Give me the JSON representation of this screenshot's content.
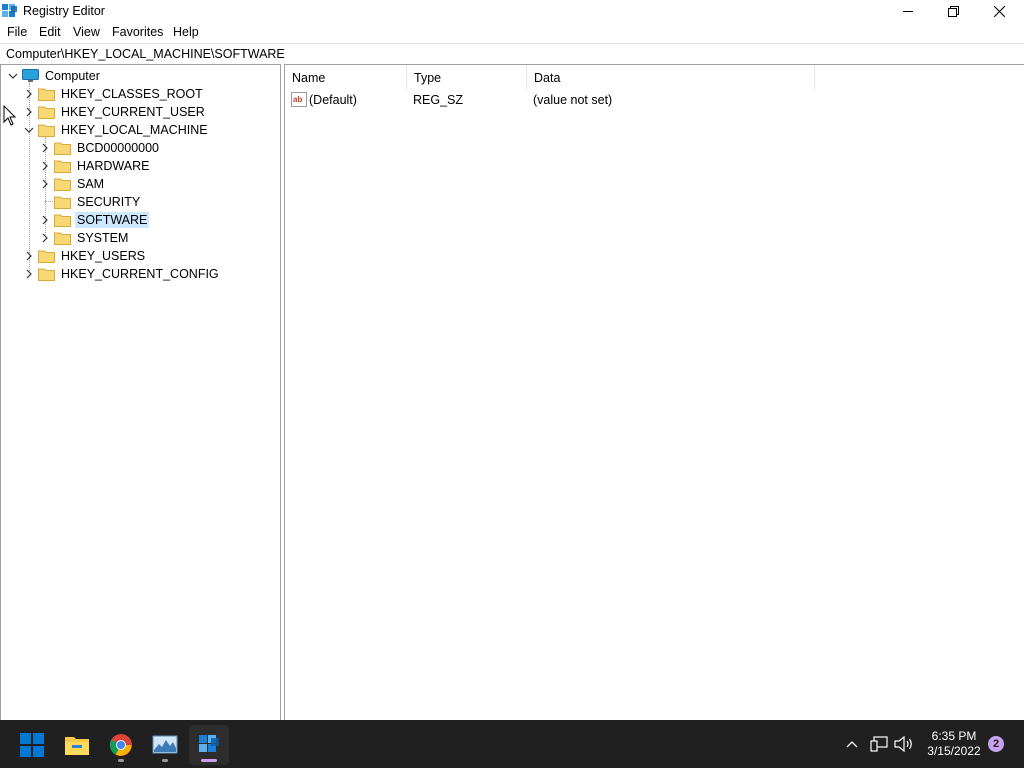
{
  "window": {
    "title": "Registry Editor"
  },
  "menu": [
    "File",
    "Edit",
    "View",
    "Favorites",
    "Help"
  ],
  "address": "Computer\\HKEY_LOCAL_MACHINE\\SOFTWARE",
  "tree": {
    "root": "Computer",
    "hives": [
      "HKEY_CLASSES_ROOT",
      "HKEY_CURRENT_USER",
      "HKEY_LOCAL_MACHINE",
      "HKEY_USERS",
      "HKEY_CURRENT_CONFIG"
    ],
    "hklm_children": [
      "BCD00000000",
      "HARDWARE",
      "SAM",
      "SECURITY",
      "SOFTWARE",
      "SYSTEM"
    ],
    "selected": "SOFTWARE"
  },
  "columns": {
    "name": "Name",
    "type": "Type",
    "data": "Data"
  },
  "values": [
    {
      "name": "(Default)",
      "type": "REG_SZ",
      "data": "(value not set)",
      "icon": "string-value-icon"
    }
  ],
  "taskbar": {
    "apps": [
      "start-icon",
      "file-explorer-icon",
      "chrome-icon",
      "performance-monitor-icon",
      "registry-editor-icon"
    ],
    "time": "6:35 PM",
    "date": "3/15/2022",
    "notifications": "2"
  },
  "colors": {
    "selection": "#cce8ff",
    "taskbar": "#202020",
    "start_blue": "#0078d4",
    "folder": "#f8d775"
  }
}
